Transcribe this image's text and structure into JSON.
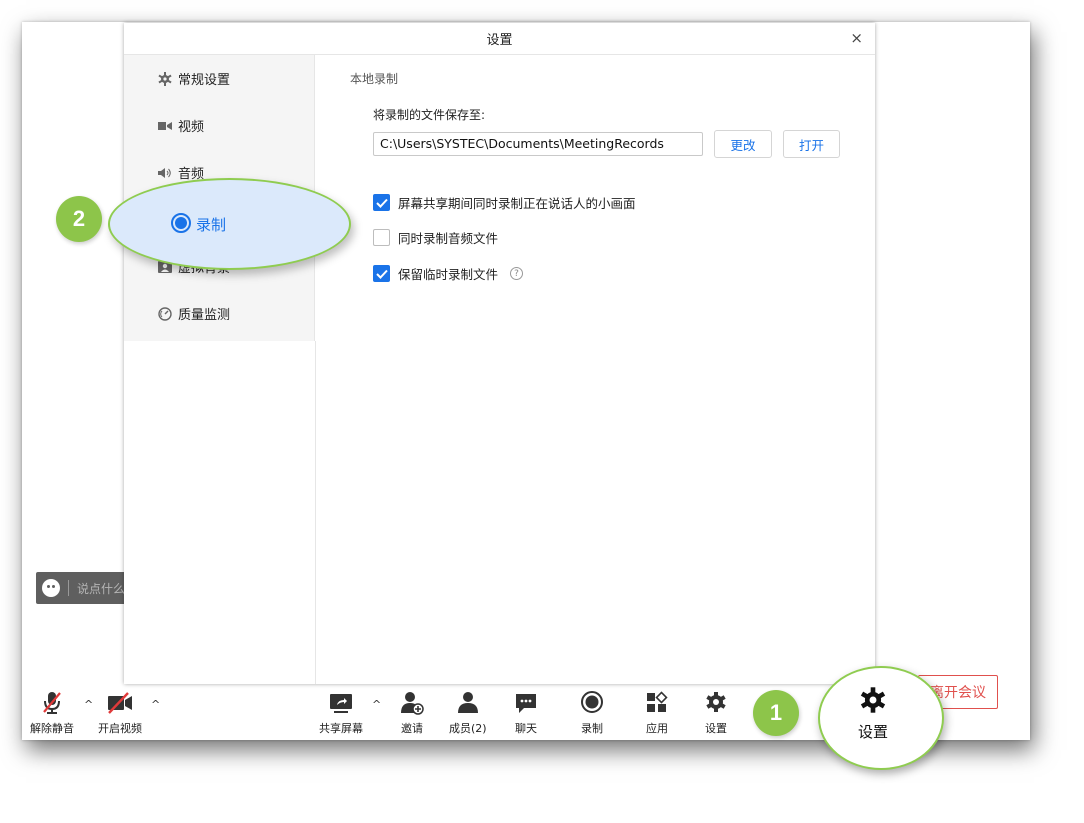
{
  "dialog": {
    "title": "设置",
    "close_glyph": "×",
    "nav": [
      {
        "label": "常规设置",
        "icon": "gear-icon"
      },
      {
        "label": "视频",
        "icon": "video-camera-icon"
      },
      {
        "label": "音频",
        "icon": "speaker-icon"
      },
      {
        "label": "录制",
        "icon": "record-icon",
        "selected": true
      },
      {
        "label": "虚拟背景",
        "icon": "portrait-icon"
      },
      {
        "label": "质量监测",
        "icon": "gauge-icon"
      }
    ],
    "section_title": "本地录制",
    "save_to_label": "将录制的文件保存至:",
    "path_value": "C:\\Users\\SYSTEC\\Documents\\MeetingRecords",
    "change_button": "更改",
    "open_button": "打开",
    "options": [
      {
        "label": "屏幕共享期间同时录制正在说话人的小画面",
        "checked": true
      },
      {
        "label": "同时录制音频文件",
        "checked": false
      },
      {
        "label": "保留临时录制文件",
        "checked": true,
        "help": "?"
      }
    ]
  },
  "chat": {
    "placeholder": "说点什么"
  },
  "toolbar": {
    "unmute": "解除静音",
    "start_video": "开启视频",
    "share_screen": "共享屏幕",
    "invite": "邀请",
    "members": "成员(2)",
    "chat": "聊天",
    "record": "录制",
    "apps": "应用",
    "settings": "设置",
    "leave": "离开会议",
    "caret": "^"
  },
  "callouts": {
    "step1": "1",
    "step2": "2",
    "settings_zoom_label": "设置",
    "record_zoom_label": "录制"
  },
  "colors": {
    "accent": "#1a73e8",
    "callout_green": "#8dc54a",
    "leave_red": "#e0504d"
  }
}
